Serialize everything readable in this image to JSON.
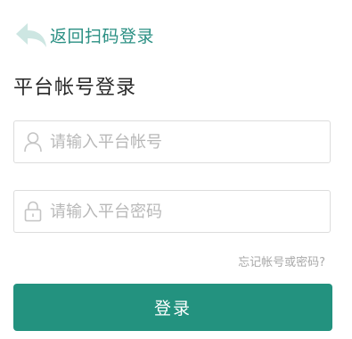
{
  "back_link": {
    "icon": "back-arrow-icon",
    "label": "返回扫码登录"
  },
  "title": "平台帐号登录",
  "fields": {
    "account": {
      "icon": "user-icon",
      "value": "",
      "placeholder": "请输入平台帐号"
    },
    "password": {
      "icon": "lock-icon",
      "value": "",
      "placeholder": "请输入平台密码"
    }
  },
  "forgot_link": "忘记帐号或密码?",
  "login_button": "登录",
  "colors": {
    "accent": "#23927f",
    "link": "#2a8f83",
    "back_icon": "#cde6e2",
    "placeholder": "#b8b8b8",
    "border": "#dcdcdc"
  }
}
